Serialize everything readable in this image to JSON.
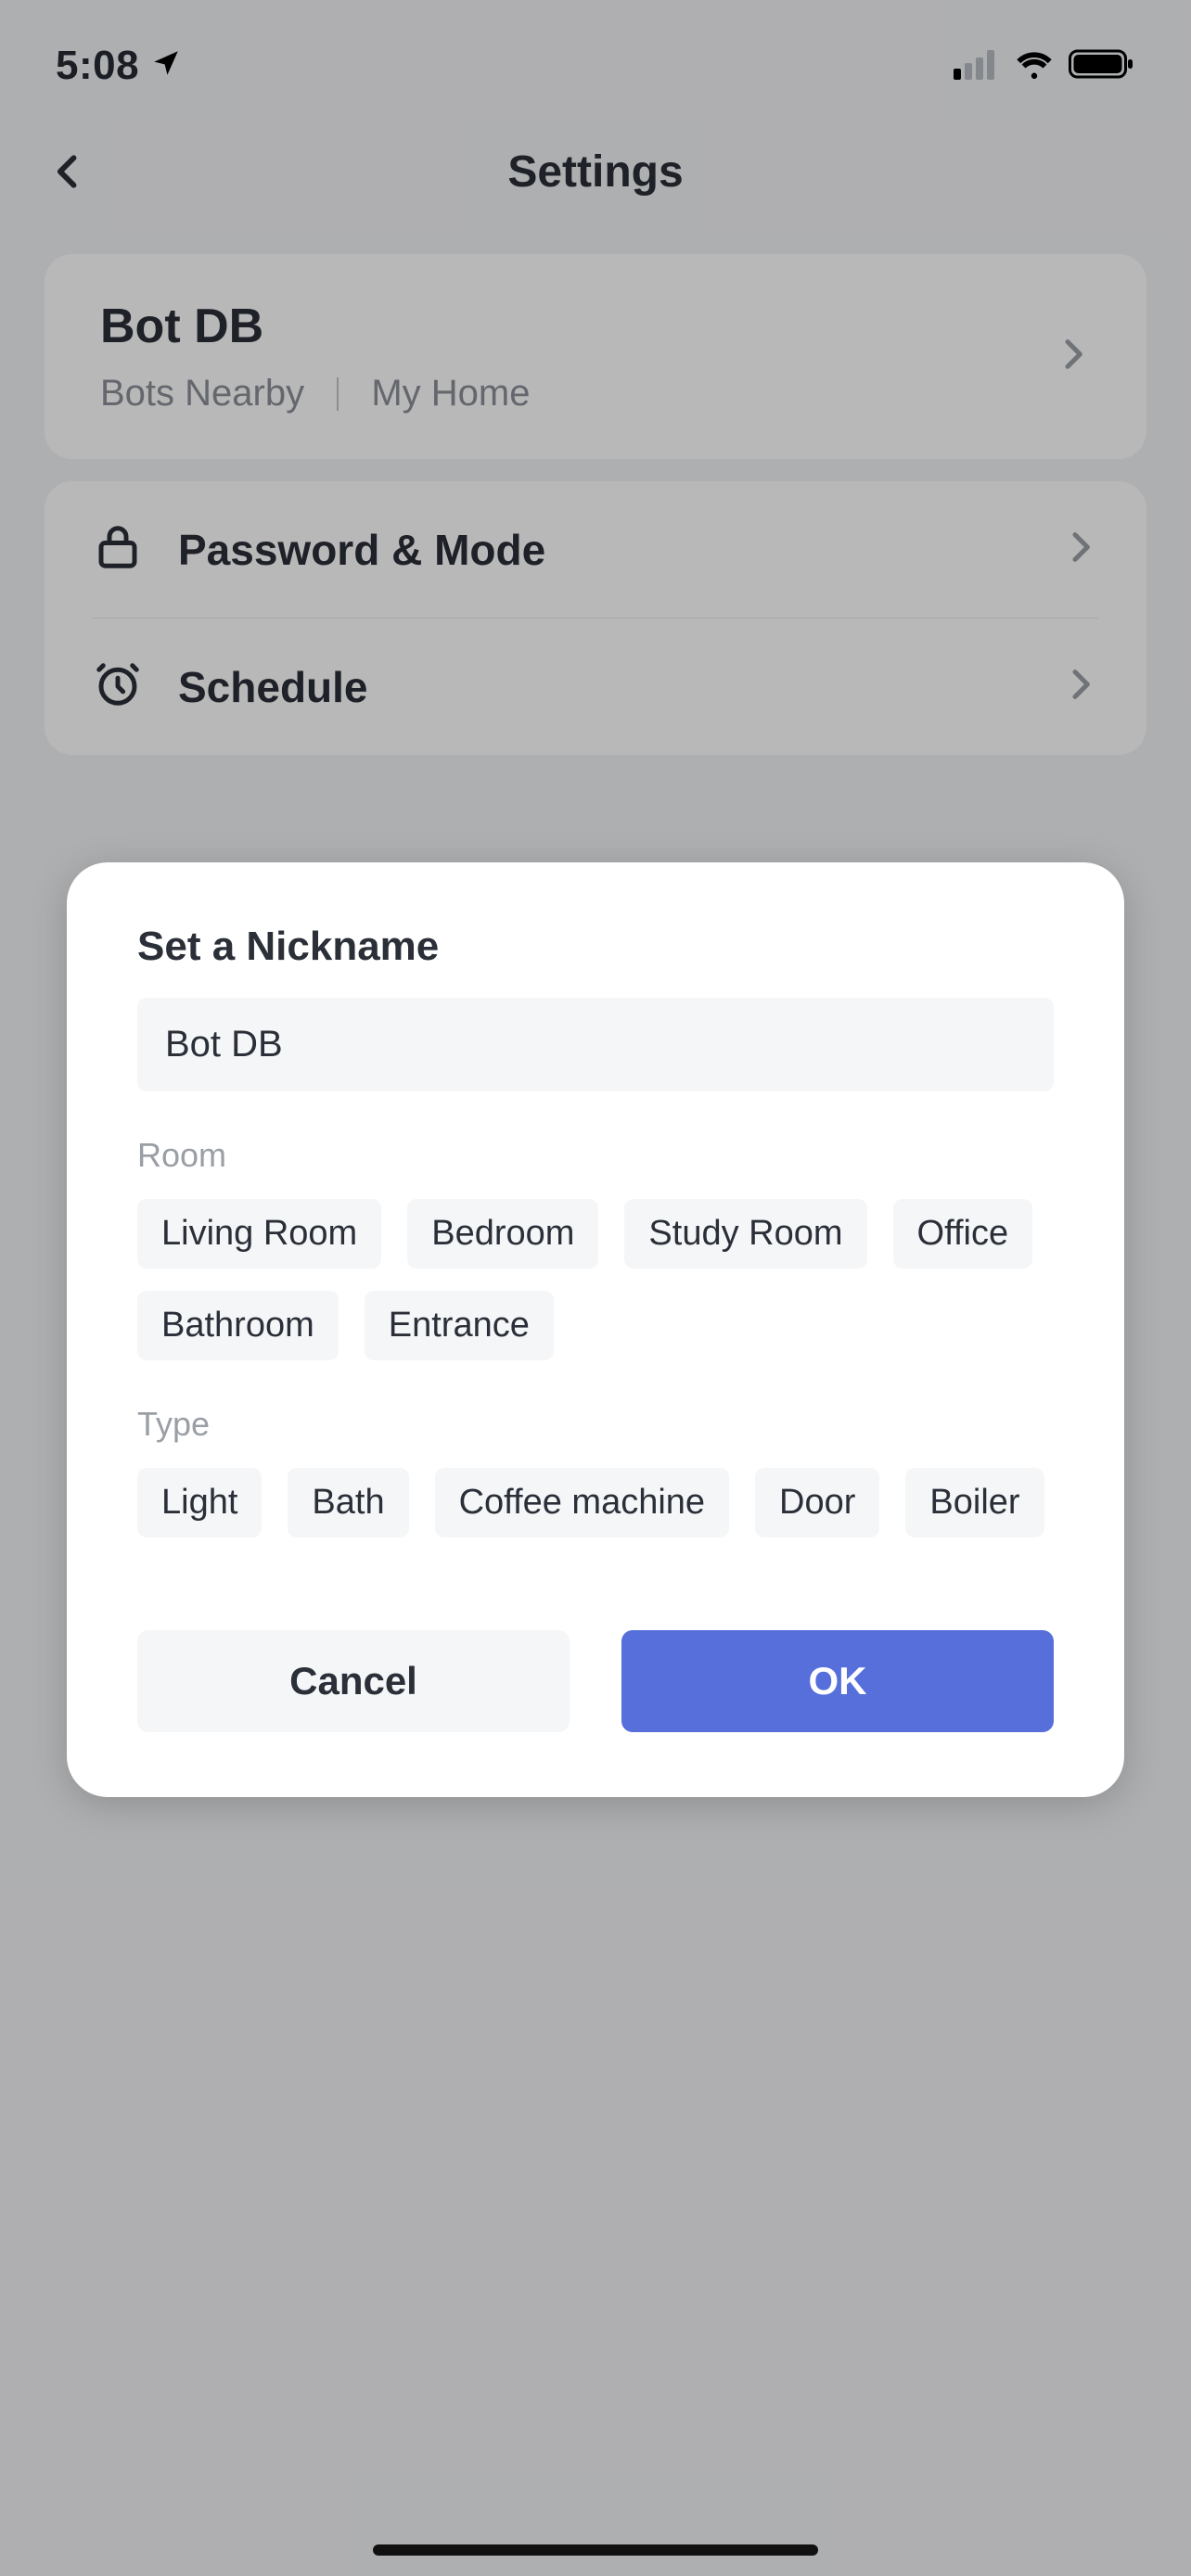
{
  "status_bar": {
    "time": "5:08"
  },
  "header": {
    "title": "Settings"
  },
  "device": {
    "name": "Bot DB",
    "group": "Bots Nearby",
    "home": "My Home"
  },
  "rows": {
    "password_mode": "Password & Mode",
    "schedule": "Schedule"
  },
  "modal": {
    "title": "Set a Nickname",
    "nickname_value": "Bot DB",
    "room_label": "Room",
    "room_options": [
      "Living Room",
      "Bedroom",
      "Study Room",
      "Office",
      "Bathroom",
      "Entrance"
    ],
    "type_label": "Type",
    "type_options": [
      "Light",
      "Bath",
      "Coffee machine",
      "Door",
      "Boiler"
    ],
    "cancel": "Cancel",
    "ok": "OK"
  }
}
